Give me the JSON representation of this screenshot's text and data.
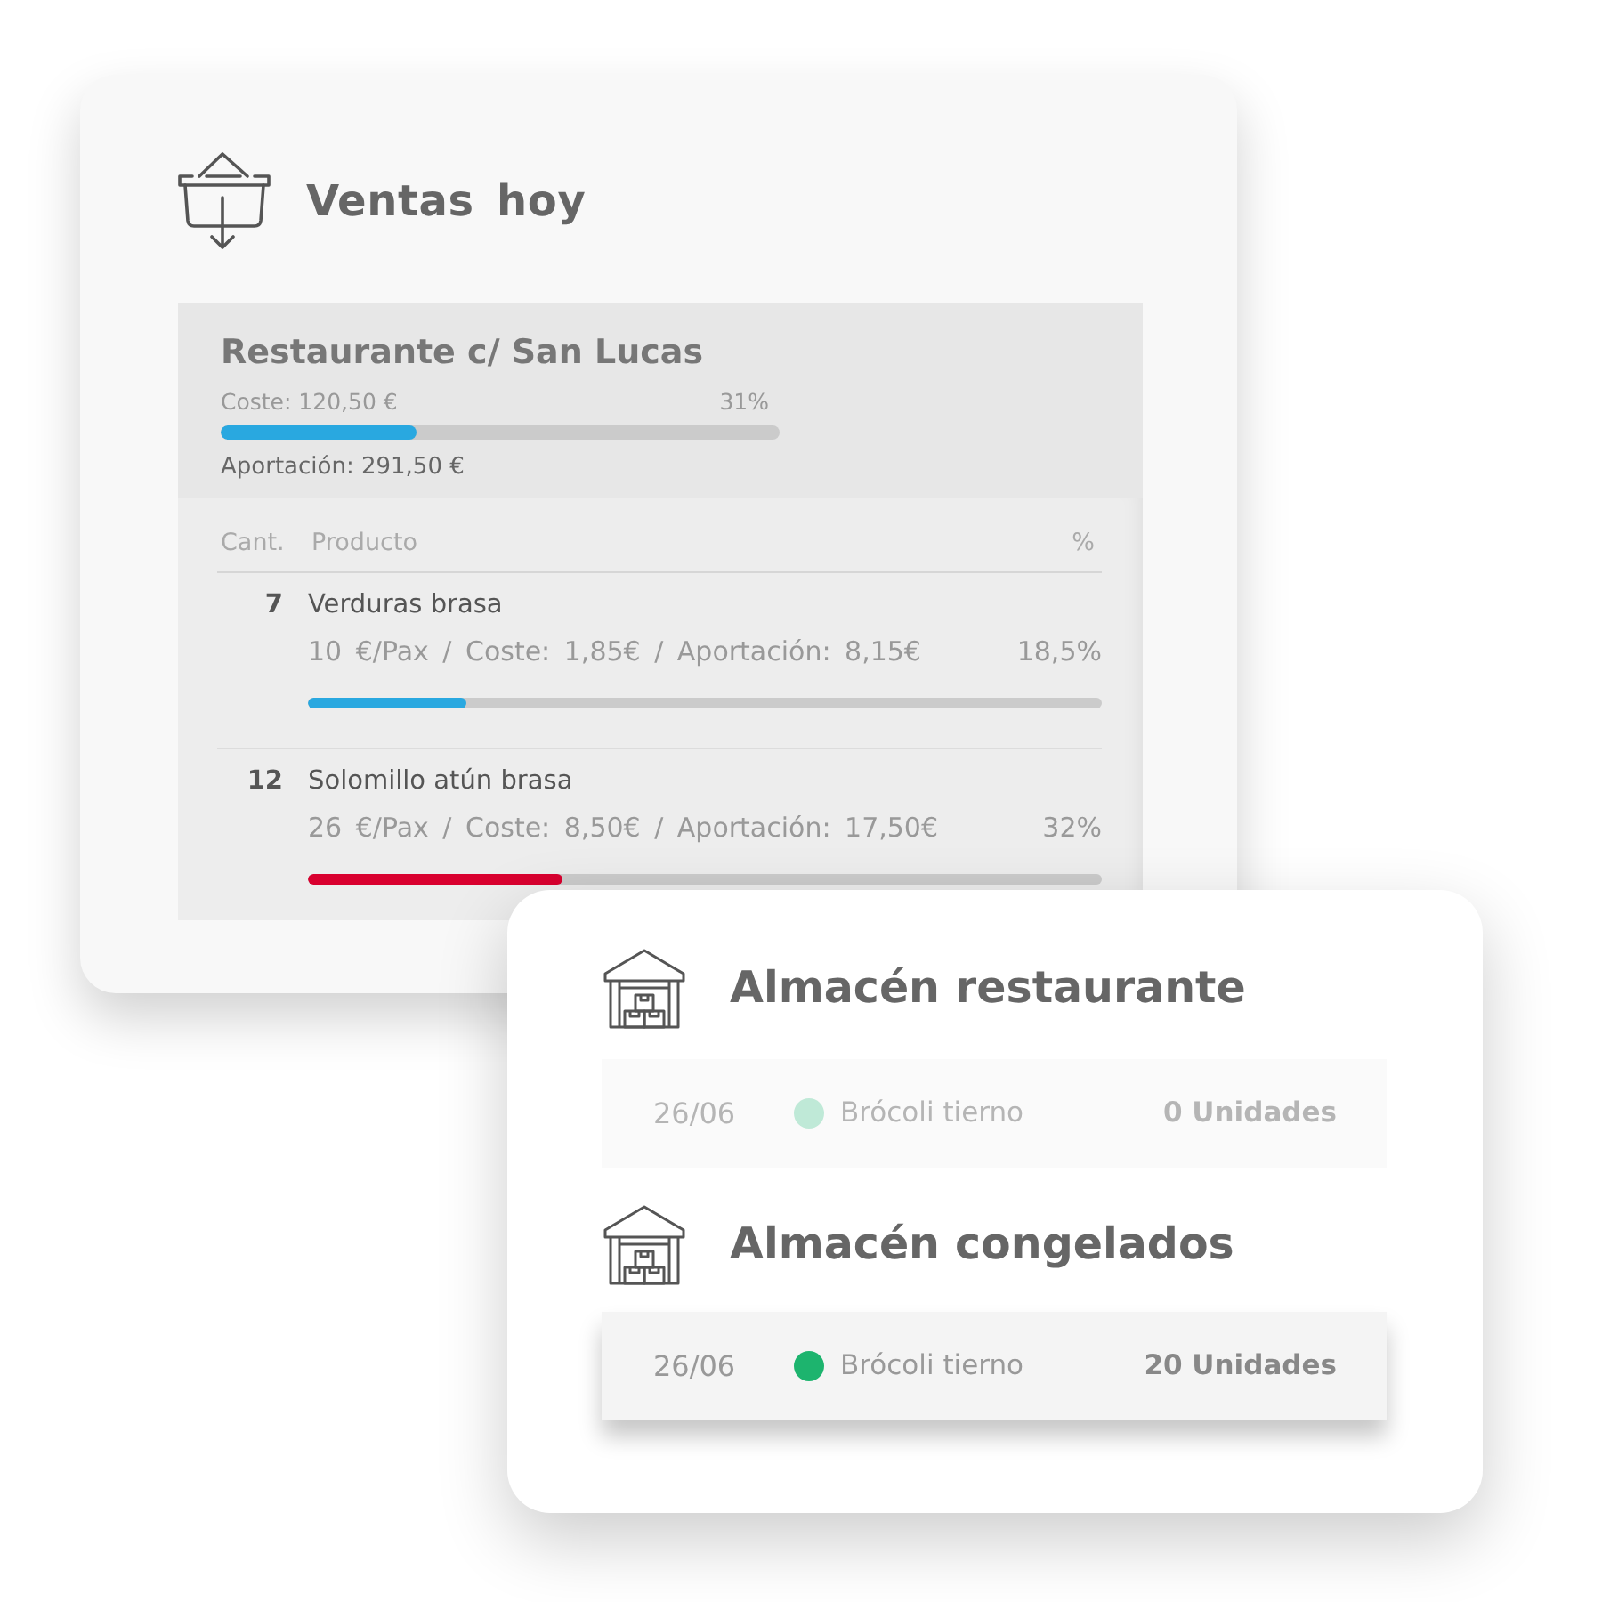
{
  "sales_card": {
    "title": "Ventas hoy",
    "restaurant": {
      "name": "Restaurante c/ San Lucas",
      "cost": "Coste: 120,50 €",
      "cost_percent": "31%",
      "level": 0.35,
      "contribution": "Aportación: 291,50 €"
    },
    "table": {
      "columns": [
        "Cant.",
        "Producto",
        "%"
      ],
      "rows": [
        {
          "quantity": "7",
          "product": "Verduras brasa",
          "details": "10 €/Pax / Coste: 1,85€ / Aportación: 8,15€",
          "percent": "18,5%",
          "level": 0.2,
          "color": "#29a8e0"
        },
        {
          "quantity": "12",
          "product": "Solomillo atún brasa",
          "details": "26 €/Pax / Coste: 8,50€ / Aportación: 17,50€",
          "percent": "32%",
          "level": 0.32,
          "color": "#d9002f"
        }
      ]
    }
  },
  "warehouses": [
    {
      "title": "Almacén restaurante",
      "items": [
        {
          "date": "26/06",
          "product": "Brócoli tierno",
          "quantity": "0 Unidades",
          "color": "#bfe9d7",
          "dimmed": true
        }
      ]
    },
    {
      "title": "Almacén congelados",
      "items": [
        {
          "date": "26/06",
          "product": "Brócoli tierno",
          "quantity": "20 Unidades",
          "color": "#1db46e",
          "dimmed": false
        }
      ]
    }
  ]
}
